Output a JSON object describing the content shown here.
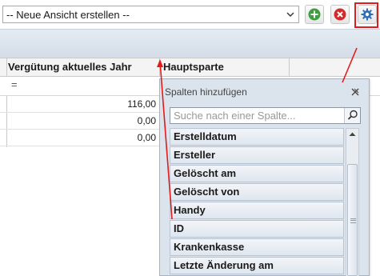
{
  "toolbar": {
    "view_select_value": "-- Neue Ansicht erstellen --",
    "add_icon": "plus-circle-icon",
    "remove_icon": "x-circle-icon",
    "settings_icon": "gear-icon",
    "colors": {
      "add": "#3f9f3f",
      "remove": "#d42a2a",
      "settings": "#2f6db5",
      "highlight": "#e21b1b"
    }
  },
  "grid": {
    "columns": [
      "Vergütung aktuelles Jahr",
      "Hauptsparte"
    ],
    "filter_symbol": "=",
    "rows": [
      {
        "amount": "116,00"
      },
      {
        "amount": "0,00"
      },
      {
        "amount": "0,00"
      }
    ]
  },
  "column_chooser": {
    "title": "Spalten hinzufügen",
    "close_icon": "close-icon",
    "search_placeholder": "Suche nach einer Spalte...",
    "search_icon": "magnifier-icon",
    "items": [
      "Erstelldatum",
      "Ersteller",
      "Gelöscht am",
      "Gelöscht von",
      "Handy",
      "ID",
      "Krankenkasse",
      "Letzte Änderung am"
    ]
  }
}
